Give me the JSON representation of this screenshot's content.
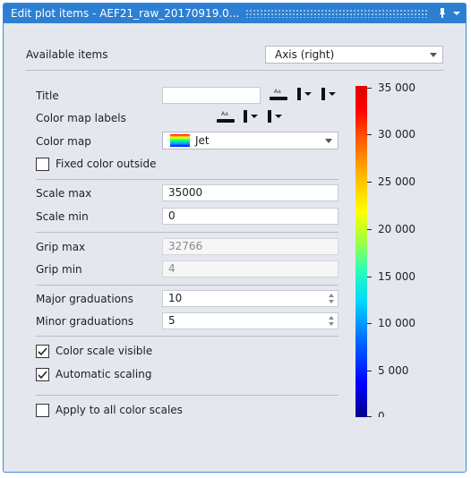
{
  "window": {
    "title": "Edit plot items - AEF21_raw_20170919.0...",
    "title_color": "#2d7fd2"
  },
  "available_items": {
    "label": "Available items",
    "value": "Axis (right)"
  },
  "title_row": {
    "label": "Title",
    "value": ""
  },
  "color_map_labels": {
    "label": "Color map labels"
  },
  "color_map": {
    "label": "Color map",
    "value": "Jet"
  },
  "fixed_color_outside": {
    "label": "Fixed color outside",
    "checked": false
  },
  "scale_max": {
    "label": "Scale max",
    "value": "35000"
  },
  "scale_min": {
    "label": "Scale min",
    "value": "0"
  },
  "grip_max": {
    "label": "Grip max",
    "value": "32766"
  },
  "grip_min": {
    "label": "Grip min",
    "value": "4"
  },
  "major_graduations": {
    "label": "Major graduations",
    "value": "10"
  },
  "minor_graduations": {
    "label": "Minor graduations",
    "value": "5"
  },
  "color_scale_visible": {
    "label": "Color scale visible",
    "checked": true
  },
  "automatic_scaling": {
    "label": "Automatic scaling",
    "checked": true
  },
  "apply_all": {
    "label": "Apply to all color scales",
    "checked": false
  },
  "color_scale": {
    "ticks": [
      "35 000",
      "30 000",
      "25 000",
      "20 000",
      "15 000",
      "10 000",
      "5 000",
      "0"
    ],
    "colormap": "Jet"
  }
}
